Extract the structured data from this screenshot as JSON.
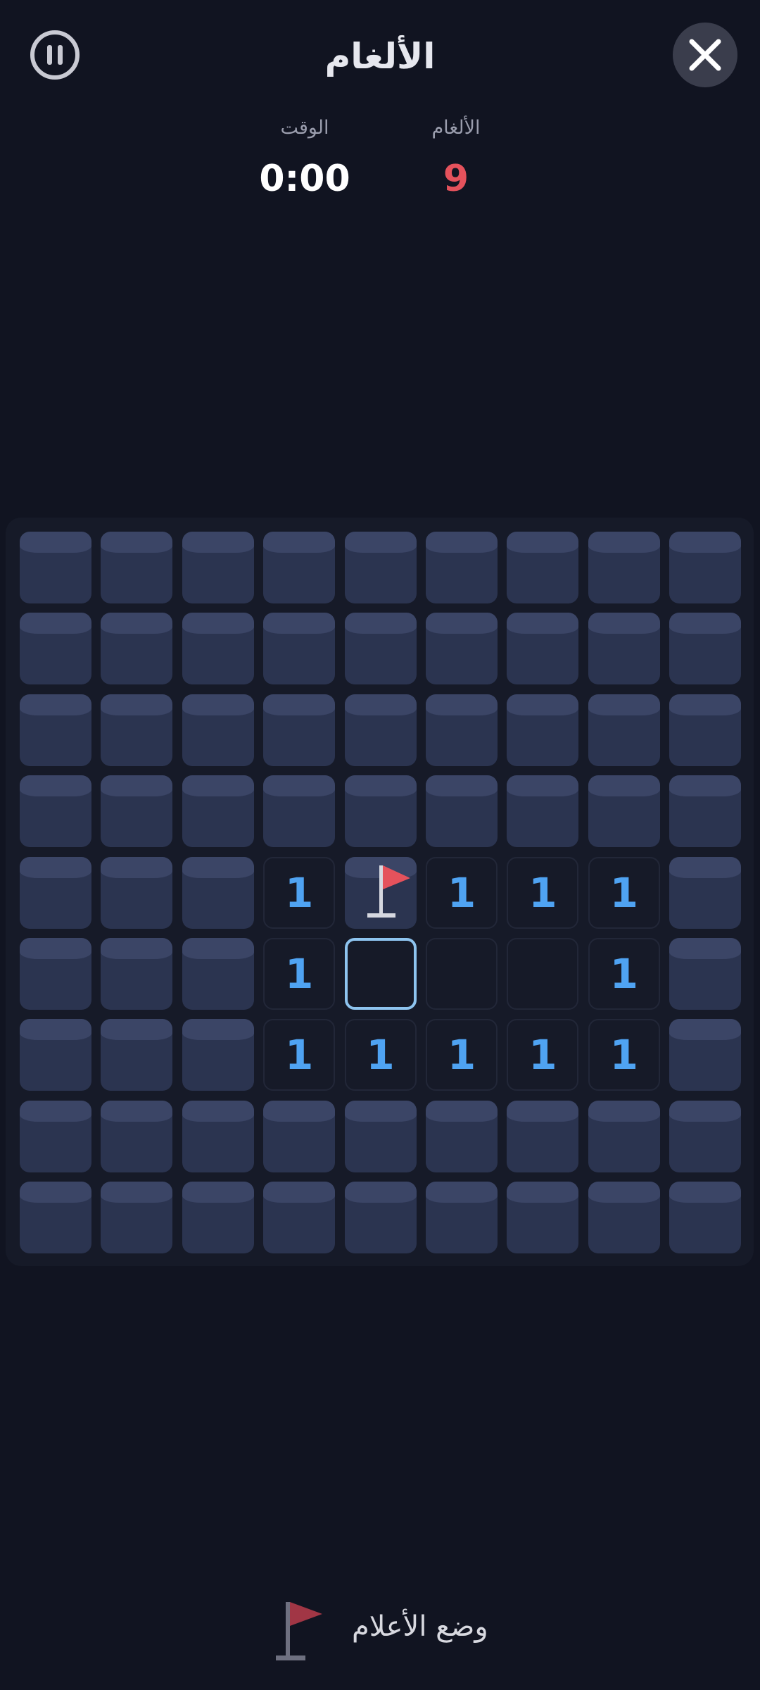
{
  "header": {
    "title": "الألغام",
    "pause_icon": "pause-icon",
    "close_icon": "close-icon"
  },
  "stats": {
    "time_label": "الوقت",
    "time_value": "0:00",
    "mines_label": "الألغام",
    "mines_value": "9"
  },
  "board": {
    "rows": 9,
    "cols": 9,
    "grid": [
      [
        "c",
        "c",
        "c",
        "c",
        "c",
        "c",
        "c",
        "c",
        "c"
      ],
      [
        "c",
        "c",
        "c",
        "c",
        "c",
        "c",
        "c",
        "c",
        "c"
      ],
      [
        "c",
        "c",
        "c",
        "c",
        "c",
        "c",
        "c",
        "c",
        "c"
      ],
      [
        "c",
        "c",
        "c",
        "c",
        "c",
        "c",
        "c",
        "c",
        "c"
      ],
      [
        "c",
        "c",
        "c",
        "1",
        "F",
        "1",
        "1",
        "1",
        "c"
      ],
      [
        "c",
        "c",
        "c",
        "1",
        "S",
        "0",
        "0",
        "1",
        "c"
      ],
      [
        "c",
        "c",
        "c",
        "1",
        "1",
        "1",
        "1",
        "1",
        "c"
      ],
      [
        "c",
        "c",
        "c",
        "c",
        "c",
        "c",
        "c",
        "c",
        "c"
      ],
      [
        "c",
        "c",
        "c",
        "c",
        "c",
        "c",
        "c",
        "c",
        "c"
      ]
    ],
    "legend": {
      "c": "covered",
      "F": "flagged",
      "S": "selected-empty",
      "0": "revealed-empty"
    }
  },
  "flag_mode": {
    "label": "وضع الأعلام",
    "icon": "flag-icon"
  },
  "colors": {
    "background": "#111421",
    "number": "#4fa3f2",
    "mines_count": "#e5525c",
    "flag": "#e5525c",
    "selected_border": "#8ec4ef"
  }
}
